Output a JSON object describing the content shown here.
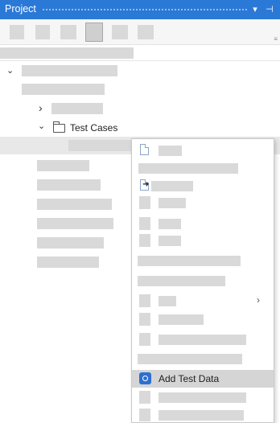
{
  "panel": {
    "title": "Project",
    "dropdown_glyph": "▾",
    "pin_glyph": "⊣"
  },
  "toolbar": {
    "overflow_glyph": "≡",
    "selected_index": 4
  },
  "tree": {
    "expand_glyph": "›",
    "collapse_glyph": "⌄",
    "test_cases_label": "Test Cases"
  },
  "context_menu": {
    "submenu_glyph": "›",
    "add_test_data_label": "Add Test Data",
    "hovered_item": "Add Test Data"
  },
  "colors": {
    "title_bar": "#2b79d7",
    "hover": "#d5d5d5",
    "placeholder": "#d9d9d9"
  },
  "icons": [
    "dropdown-icon",
    "pin-icon",
    "chevron-right-icon",
    "chevron-down-icon",
    "folder-icon",
    "file-icon",
    "arrow-icon",
    "test-data-icon"
  ]
}
